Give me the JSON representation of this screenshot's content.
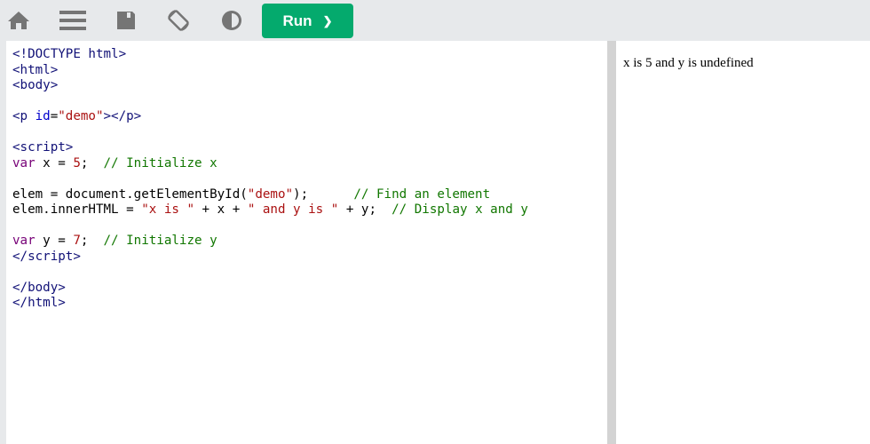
{
  "toolbar": {
    "icons": [
      "home-icon",
      "menu-icon",
      "save-icon",
      "rotate-icon",
      "contrast-icon"
    ],
    "run_label": "Run",
    "run_chevron": "❯",
    "accent": "#04aa6d"
  },
  "editor": {
    "lines": [
      [
        [
          "tag",
          "<!DOCTYPE html>"
        ]
      ],
      [
        [
          "tag",
          "<html>"
        ]
      ],
      [
        [
          "tag",
          "<body>"
        ]
      ],
      [],
      [
        [
          "tag",
          "<p "
        ],
        [
          "attr",
          "id"
        ],
        [
          "txt",
          "="
        ],
        [
          "str",
          "\"demo\""
        ],
        [
          "tag",
          "></p>"
        ]
      ],
      [],
      [
        [
          "tag",
          "<script>"
        ]
      ],
      [
        [
          "kw",
          "var"
        ],
        [
          "txt",
          " x = "
        ],
        [
          "num",
          "5"
        ],
        [
          "txt",
          ";  "
        ],
        [
          "com",
          "// Initialize x"
        ]
      ],
      [],
      [
        [
          "txt",
          "elem = document.getElementById("
        ],
        [
          "str",
          "\"demo\""
        ],
        [
          "txt",
          ");      "
        ],
        [
          "com",
          "// Find an element"
        ]
      ],
      [
        [
          "txt",
          "elem.innerHTML = "
        ],
        [
          "str",
          "\"x is \""
        ],
        [
          "txt",
          " + x + "
        ],
        [
          "str",
          "\" and y is \""
        ],
        [
          "txt",
          " + y;  "
        ],
        [
          "com",
          "// Display x and y"
        ]
      ],
      [],
      [
        [
          "kw",
          "var"
        ],
        [
          "txt",
          " y = "
        ],
        [
          "num",
          "7"
        ],
        [
          "txt",
          ";  "
        ],
        [
          "com",
          "// Initialize y"
        ]
      ],
      [
        [
          "tag",
          "</script>"
        ]
      ],
      [],
      [
        [
          "tag",
          "</body>"
        ]
      ],
      [
        [
          "tag",
          "</html>"
        ]
      ]
    ]
  },
  "result": {
    "text": "x is 5 and y is undefined"
  }
}
